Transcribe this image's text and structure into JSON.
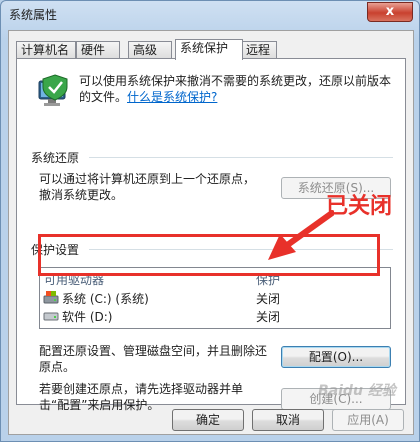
{
  "window": {
    "title": "系统属性",
    "close_label": "x"
  },
  "tabs": [
    {
      "label": "计算机名"
    },
    {
      "label": "硬件"
    },
    {
      "label": "高级"
    },
    {
      "label": "系统保护"
    },
    {
      "label": "远程"
    }
  ],
  "active_tab": "系统保护",
  "info": {
    "text": "可以使用系统保护来撤消不需要的系统更改，还原以前版本的文件。",
    "link": "什么是系统保护?"
  },
  "restore": {
    "section_label": "系统还原",
    "description": "可以通过将计算机还原到上一个还原点，撤消系统更改。",
    "button": "系统还原(S)..."
  },
  "protection": {
    "section_label": "保护设置",
    "columns": [
      "可用驱动器",
      "保护"
    ],
    "drives": [
      {
        "name": "系统 (C:) (系统)",
        "status": "关闭",
        "icon": "system-drive-icon"
      },
      {
        "name": "软件 (D:)",
        "status": "关闭",
        "icon": "drive-icon"
      }
    ],
    "config_text": "配置还原设置、管理磁盘空间，并且删除还原点。",
    "config_button": "配置(O)...",
    "create_text": "若要创建还原点，请先选择驱动器并单击“配置”来启用保护。",
    "create_button": "创建(C)..."
  },
  "annotation": {
    "text": "已关闭",
    "color": "#e8312a"
  },
  "footer": {
    "ok": "确定",
    "cancel": "取消",
    "apply": "应用(A)"
  },
  "watermark": "Baidu 经验"
}
